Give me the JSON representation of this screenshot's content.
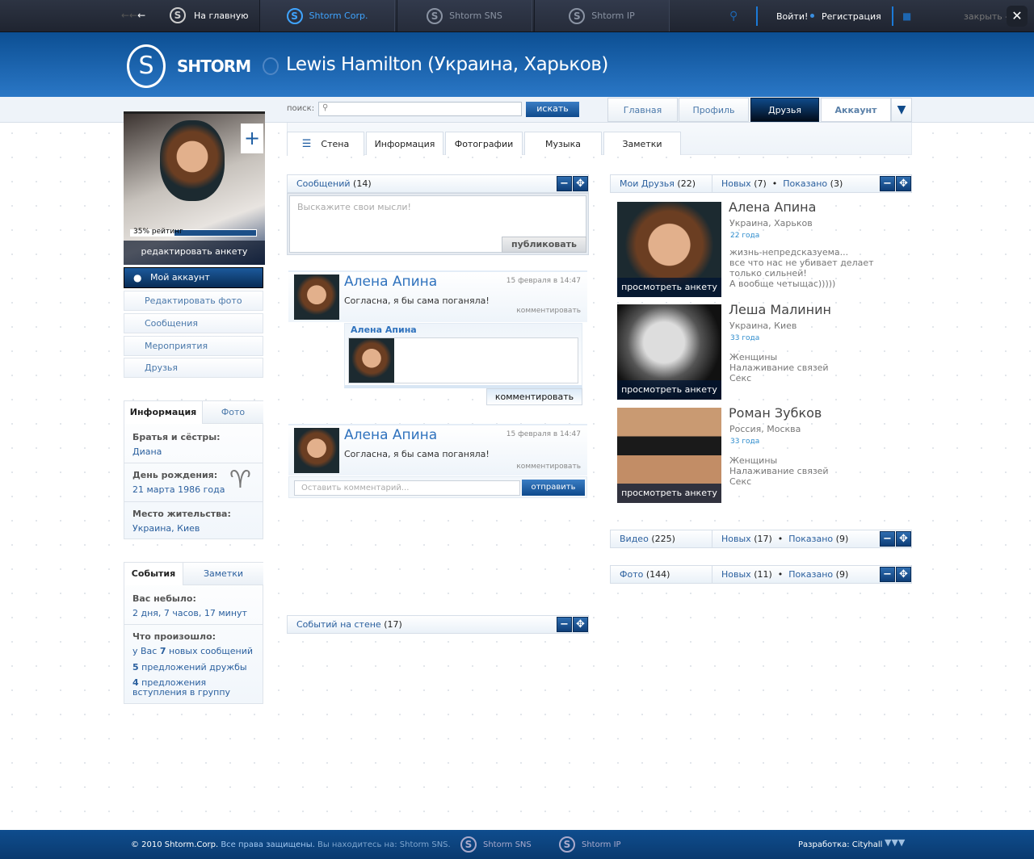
{
  "topbar": {
    "home": "На главную",
    "tabs": [
      "Shtorm Corp.",
      "Shtorm SNS",
      "Shtorm IP"
    ],
    "login": "Войти!",
    "register": "Регистрация",
    "close": "закрыть -"
  },
  "header": {
    "logo": "SHTORM",
    "title": "Lewis Hamilton (Украина, Харьков)"
  },
  "search": {
    "label": "поиск:",
    "placeholder": "",
    "button": "искать"
  },
  "nav": [
    "Главная",
    "Профиль",
    "Друзья",
    "Аккаунт"
  ],
  "subtabs": [
    "Стена",
    "Информация",
    "Фотографии",
    "Музыка",
    "Заметки"
  ],
  "profile": {
    "rating": "35% рейтинг",
    "rating_percent": 35,
    "edit": "редактировать анкету"
  },
  "sidebar": {
    "account": "Мой аккаунт",
    "items": [
      "Редактировать фото",
      "Сообщения",
      "Мероприятия",
      "Друзья"
    ]
  },
  "info": {
    "tabs": [
      "Информация",
      "Фото"
    ],
    "rows": [
      {
        "label": "Братья и сёстры:",
        "value": "Диана"
      },
      {
        "label": "День рождения:",
        "value": "21 марта 1986 года"
      },
      {
        "label": "Место жительства:",
        "value": "Украина, Киев"
      }
    ]
  },
  "events": {
    "tabs": [
      "События",
      "Заметки"
    ],
    "away_label": "Вас небыло:",
    "away_value": "2 дня, 7 часов, 17 минут",
    "happened_label": "Что произошло:",
    "lines": [
      {
        "pre": "у Вас ",
        "num": "7",
        "post": " новых сообщений"
      },
      {
        "pre": "",
        "num": "5",
        "post": " предложений дружбы"
      },
      {
        "pre": "",
        "num": "4",
        "post": " предложения вступления в группу"
      }
    ]
  },
  "wall": {
    "messages_label": "Сообщений",
    "messages_count": "(14)",
    "placeholder": "Выскажите свои мысли!",
    "publish": "публиковать",
    "posts": [
      {
        "author": "Алена Апина",
        "date": "15 февраля в 14:47",
        "text": "Согласна, я бы сама поганяла!",
        "comment": "комментировать"
      },
      {
        "author": "Алена Апина",
        "date": "15 февраля в 14:47",
        "text": "Согласна, я бы сама поганяла!",
        "comment": "комментировать"
      }
    ],
    "nested_author": "Алена Апина",
    "nested_comment": "комментировать",
    "comment_placeholder": "Оставить комментарий...",
    "send": "отправить",
    "events_label": "Событий на стене",
    "events_count": "(17)"
  },
  "friends": {
    "label": "Мои Друзья",
    "count": "(22)",
    "new_label": "Новых",
    "new_count": "(7)",
    "shown_label": "Показано",
    "shown_count": "(3)",
    "view": "просмотреть анкету",
    "list": [
      {
        "name": "Алена Апина",
        "place": "Украина, Харьков",
        "age": "22 года",
        "desc": [
          "жизнь-непредсказуема...",
          "все что нас не убивает делает только сильней!",
          "А вообще четыщас)))))"
        ]
      },
      {
        "name": "Леша Малинин",
        "place": "Украина, Киев",
        "age": "33 года",
        "desc": [
          "Женщины",
          "Налаживание связей",
          "Секс"
        ]
      },
      {
        "name": "Роман Зубков",
        "place": "Россия, Москва",
        "age": "33 года",
        "desc": [
          "Женщины",
          "Налаживание связей",
          "Секс"
        ]
      }
    ]
  },
  "video": {
    "label": "Видео",
    "count": "(225)",
    "new_label": "Новых",
    "new_count": "(17)",
    "shown_label": "Показано",
    "shown_count": "(9)"
  },
  "photo": {
    "label": "Фото",
    "count": "(144)",
    "new_label": "Новых",
    "new_count": "(11)",
    "shown_label": "Показано",
    "shown_count": "(9)"
  },
  "footer": {
    "copyright": "© 2010 Shtorm.Corp.",
    "rights": "Все права защищены.",
    "location": "Вы находитесь на: Shtorm SNS.",
    "links": [
      "Shtorm SNS",
      "Shtorm IP"
    ],
    "dev": "Разработка: Cityhall"
  }
}
